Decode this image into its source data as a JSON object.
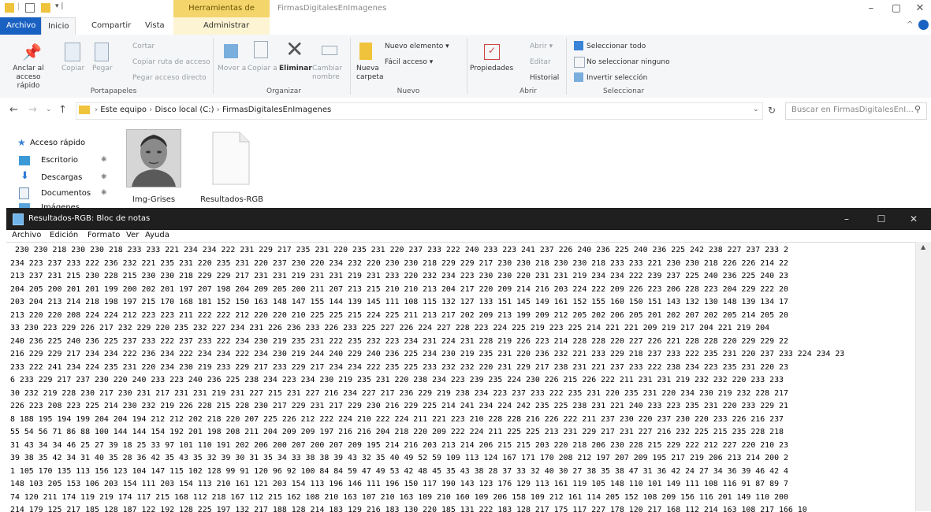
{
  "explorer": {
    "contextual_tab_title": "Herramientas de imagen",
    "window_title": "FirmasDigitalesEnImagenes",
    "tabs": [
      "Archivo",
      "Inicio",
      "Compartir",
      "Vista"
    ],
    "contextual_subtab": "Administrar",
    "ribbon": {
      "portapapeles": {
        "anclar": "Anclar al acceso rápido",
        "copiar": "Copiar",
        "pegar": "Pegar",
        "cortar": "Cortar",
        "copiar_ruta": "Copiar ruta de acceso",
        "pegar_acceso": "Pegar acceso directo",
        "label": "Portapapeles"
      },
      "organizar": {
        "mover": "Mover a",
        "copiar_a": "Copiar a",
        "eliminar": "Eliminar",
        "cambiar_nombre": "Cambiar nombre",
        "label": "Organizar"
      },
      "nuevo": {
        "nueva_carpeta": "Nueva carpeta",
        "nuevo_elemento": "Nuevo elemento",
        "facil_acceso": "Fácil acceso",
        "label": "Nuevo"
      },
      "abrir": {
        "propiedades": "Propiedades",
        "abrir": "Abrir",
        "editar": "Editar",
        "historial": "Historial",
        "label": "Abrir"
      },
      "seleccionar": {
        "todo": "Seleccionar todo",
        "ninguno": "No seleccionar ninguno",
        "invertir": "Invertir selección",
        "label": "Seleccionar"
      }
    },
    "address": {
      "crumbs": [
        "Este equipo",
        "Disco local (C:)",
        "FirmasDigitalesEnImagenes"
      ],
      "search_placeholder": "Buscar en FirmasDigitalesEnI..."
    },
    "nav": {
      "quick_access": "Acceso rápido",
      "items": [
        "Escritorio",
        "Descargas",
        "Documentos",
        "Imágenes"
      ]
    },
    "files": [
      {
        "name": "Img-Grises"
      },
      {
        "name": "Resultados-RGB"
      }
    ]
  },
  "notepad": {
    "title": "Resultados-RGB: Bloc de notas",
    "menu": [
      "Archivo",
      "Edición",
      "Formato",
      "Ver",
      "Ayuda"
    ],
    "lines": [
      " 230 230 218 230 230 218 233 233 221 234 234 222 231 229 217 235 231 220 235 231 220 237 233 222 240 233 223 241 237 226 240 236 225 240 236 225 242 238 227 237 233 2",
      "234 223 237 233 222 236 232 221 235 231 220 235 231 220 237 230 220 234 232 220 230 230 218 229 229 217 230 230 218 230 230 218 233 233 221 230 230 218 226 226 214 22",
      "213 237 231 215 230 228 215 230 230 218 229 229 217 231 231 219 231 231 219 231 233 220 232 234 223 230 230 220 231 231 219 234 234 222 239 237 225 240 236 225 240 23",
      "204 205 200 201 201 199 200 202 201 197 207 198 204 209 205 200 211 207 213 215 210 210 213 204 217 220 209 214 216 203 224 222 209 226 223 206 228 223 204 229 222 20",
      "203 204 213 214 218 198 197 215 170 168 181 152 150 163 148 147 155 144 139 145 111 108 115 132 127 133 151 145 149 161 152 155 160 150 151 143 132 130 148 139 134 17",
      "213 220 220 208 224 224 212 223 223 211 222 222 212 220 220 210 225 225 215 224 225 211 213 217 202 209 213 199 209 212 205 202 206 205 201 202 207 202 205 214 205 20",
      "33 230 223 229 226 217 232 229 220 235 232 227 234 231 226 236 233 226 233 225 227 226 224 227 228 223 224 225 219 223 225 214 221 221 209 219 217 204 221 219 204",
      "240 236 225 240 236 225 237 233 222 237 233 222 234 230 219 235 231 222 235 232 223 234 231 224 231 228 219 226 223 214 228 228 220 227 226 221 228 228 220 229 229 22",
      "216 229 229 217 234 234 222 236 234 222 234 234 222 234 230 219 244 240 229 240 236 225 234 230 219 235 231 220 236 232 221 233 229 218 237 233 222 235 231 220 237 233 224 234 23",
      "233 222 241 234 224 235 231 220 234 230 219 233 229 217 233 229 217 234 234 222 235 225 233 232 232 220 231 229 217 238 231 221 237 233 222 238 234 223 235 231 220 23",
      "6 233 229 217 237 230 220 240 233 223 240 236 225 238 234 223 234 230 219 235 231 220 238 234 223 239 235 224 230 226 215 226 222 211 231 231 219 232 232 220 233 233",
      "30 232 219 228 230 217 230 231 217 231 231 219 231 227 215 231 227 216 234 227 217 236 229 219 238 234 223 237 233 222 235 231 220 235 231 220 234 230 219 232 228 217",
      "226 223 208 223 225 214 230 232 219 226 228 215 228 230 217 229 231 217 229 230 216 229 225 214 241 234 224 242 235 225 238 231 221 240 233 223 235 231 220 233 229 21",
      "8 188 195 194 199 204 204 194 212 212 202 218 220 207 225 226 212 222 224 210 222 224 211 221 223 210 228 228 216 226 222 211 237 230 220 237 230 220 233 226 216 237",
      "55 54 56 71 86 88 100 144 144 154 192 201 198 208 211 204 209 209 197 216 216 204 218 220 209 222 224 211 225 225 213 231 229 217 231 227 216 232 225 215 235 228 218",
      "31 43 34 34 46 25 27 39 18 25 33 97 101 110 191 202 206 200 207 200 207 209 195 214 216 203 213 214 206 215 215 203 220 218 206 230 228 215 229 222 212 227 220 210 23",
      "39 38 35 42 34 31 40 35 28 36 42 35 43 35 32 39 30 31 35 34 33 38 38 39 43 32 35 40 49 52 59 109 113 124 167 171 170 208 212 197 207 209 195 217 219 206 213 214 200 2",
      "1 105 170 135 113 156 123 104 147 115 102 128 99 91 120 96 92 100 84 84 59 47 49 53 42 48 45 35 43 38 28 37 33 32 40 30 27 38 35 38 47 31 36 42 24 27 34 36 39 46 42 4",
      "148 103 205 153 106 203 154 111 203 154 113 210 161 121 203 154 113 196 146 111 196 150 117 190 143 123 176 129 113 161 119 105 148 110 101 149 111 108 116 91 87 89 7",
      "74 120 211 174 119 219 174 117 215 168 112 218 167 112 215 162 108 210 163 107 210 163 109 210 160 109 206 158 109 212 161 114 205 152 108 209 156 116 201 149 110 200",
      "214 179 125 217 185 128 187 122 192 128 225 197 132 217 188 128 214 183 129 216 183 130 220 185 131 222 183 128 217 175 117 227 178 120 217 168 112 214 163 108 217 166 10",
      "103 77 70 168 132 119 187 144 113 185 137 99 184 141 101 209 151 108 208 157 110 211 165 116 222 176 126 222 181 125 225 185 124 225 185 124 225 185 124 229 188 132 2"
    ]
  }
}
